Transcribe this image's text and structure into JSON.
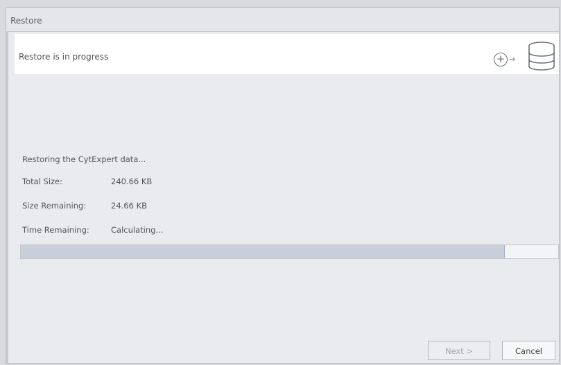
{
  "window": {
    "title": "Restore"
  },
  "header": {
    "text": "Restore is in progress",
    "icons": [
      "plus-circle-icon",
      "arrow-icon",
      "database-icon"
    ]
  },
  "status": "Restoring the CytExpert data...",
  "details": [
    {
      "label": "Total Size:",
      "value": "240.66 KB"
    },
    {
      "label": "Size Remaining:",
      "value": "24.66 KB"
    },
    {
      "label": "Time Remaining:",
      "value": "Calculating..."
    }
  ],
  "progress": {
    "fraction": 0.9
  },
  "buttons": {
    "next_label": "Next >",
    "next_enabled": false,
    "cancel_label": "Cancel"
  }
}
